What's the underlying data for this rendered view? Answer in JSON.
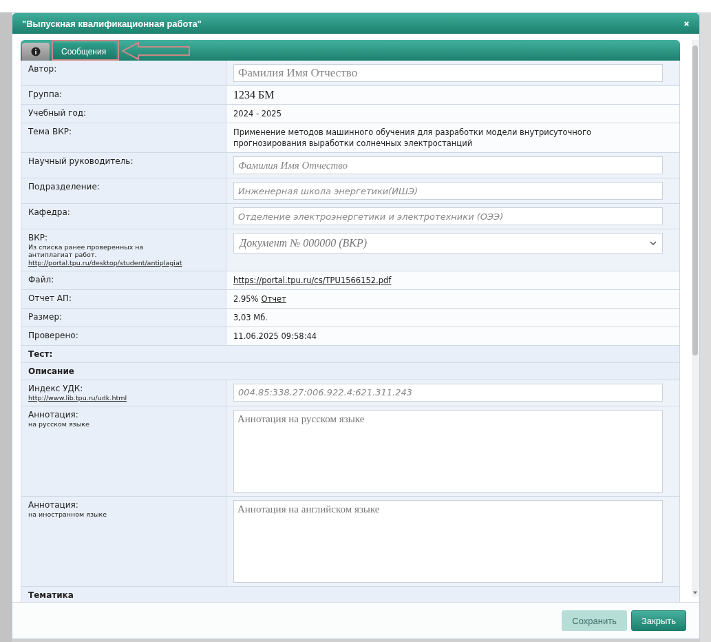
{
  "dialog": {
    "title": "\"Выпускная квалификационная работа\""
  },
  "tabs": [
    {
      "kind": "icon",
      "selected": true
    },
    {
      "kind": "label",
      "label": "Сообщения",
      "selected": false
    }
  ],
  "rows": [
    {
      "kind": "name-input",
      "label": "Автор:",
      "placeholder": "Фамилия Имя Отчество"
    },
    {
      "kind": "large-text",
      "label": "Группа:",
      "value": "1234 БМ"
    },
    {
      "kind": "text",
      "label": "Учебный год:",
      "value": "2024 - 2025"
    },
    {
      "kind": "text",
      "label": "Тема ВКР:",
      "value": "Применение методов машинного обучения для разработки модели внутрисуточного прогнозирования выработки солнечных электростанций"
    },
    {
      "kind": "italic-name-input",
      "label": "Научный руководитель:",
      "placeholder": "Фамилия Имя Отчество"
    },
    {
      "kind": "input",
      "label": "Подразделение:",
      "placeholder": "Инженерная школа энергетики(ИШЭ)"
    },
    {
      "kind": "input",
      "label": "Кафедра:",
      "placeholder": "Отделение электроэнергетики и электротехники (ОЭЭ)"
    },
    {
      "kind": "select",
      "label": "ВКР:",
      "note": "Из списка ранее проверенных на антиплагиат работ.",
      "link": "http://portal.tpu.ru/desktop/student/antiplagiat",
      "placeholder": "Документ № 000000 (ВКР)"
    },
    {
      "kind": "link",
      "label": "Файл:",
      "value": "https://portal.tpu.ru/cs/TPU1566152.pdf"
    },
    {
      "kind": "report",
      "label": "Отчет АП:",
      "value": "2.95%",
      "value_link": "Отчет"
    },
    {
      "kind": "text",
      "label": "Размер:",
      "value": "3,03 Мб."
    },
    {
      "kind": "text",
      "label": "Проверено:",
      "value": "11.06.2025 09:58:44"
    },
    {
      "kind": "section",
      "label": "Тест:"
    },
    {
      "kind": "section",
      "label": "Описание"
    },
    {
      "kind": "input",
      "label": "Индекс УДК:",
      "link": "http://www.lib.tpu.ru/udk.html",
      "placeholder": "004.85:338.27:006.922.4:621.311.243"
    },
    {
      "kind": "textarea",
      "label": "Аннотация:",
      "note": "на русском языке",
      "placeholder": "Аннотация на русском языке"
    },
    {
      "kind": "textarea",
      "label": "Аннотация:",
      "note": "на иностранном языке",
      "placeholder": "Аннотация на английском языке"
    },
    {
      "kind": "section",
      "label": "Тематика"
    }
  ],
  "buttons": [
    {
      "label": "Сохранить",
      "disabled": true
    },
    {
      "label": "Закрыть",
      "disabled": false
    }
  ]
}
